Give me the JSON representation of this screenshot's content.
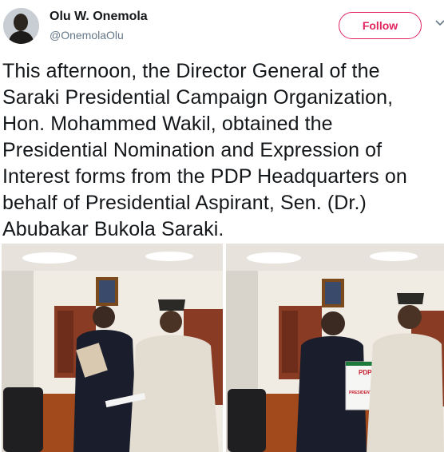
{
  "author": {
    "display_name": "Olu W. Onemola",
    "handle": "@OnemolaOlu"
  },
  "follow_button": {
    "label": "Follow"
  },
  "tweet": {
    "text": "This afternoon, the Director General of the\nSaraki Presidential Campaign Organization,\nHon. Mohammed Wakil, obtained the\nPresidential Nomination and Expression of\nInterest forms from the PDP Headquarters on\nbehalf of Presidential Aspirant, Sen. (Dr.)\nAbubakar Bukola Saraki."
  },
  "media": {
    "photos": [
      {
        "description_icon": "photo-1"
      },
      {
        "description_icon": "photo-2",
        "form_label": "PRESIDENTIAL"
      }
    ]
  },
  "colors": {
    "follow_accent": "#e0245e",
    "handle_gray": "#657786",
    "text": "#14171a"
  }
}
